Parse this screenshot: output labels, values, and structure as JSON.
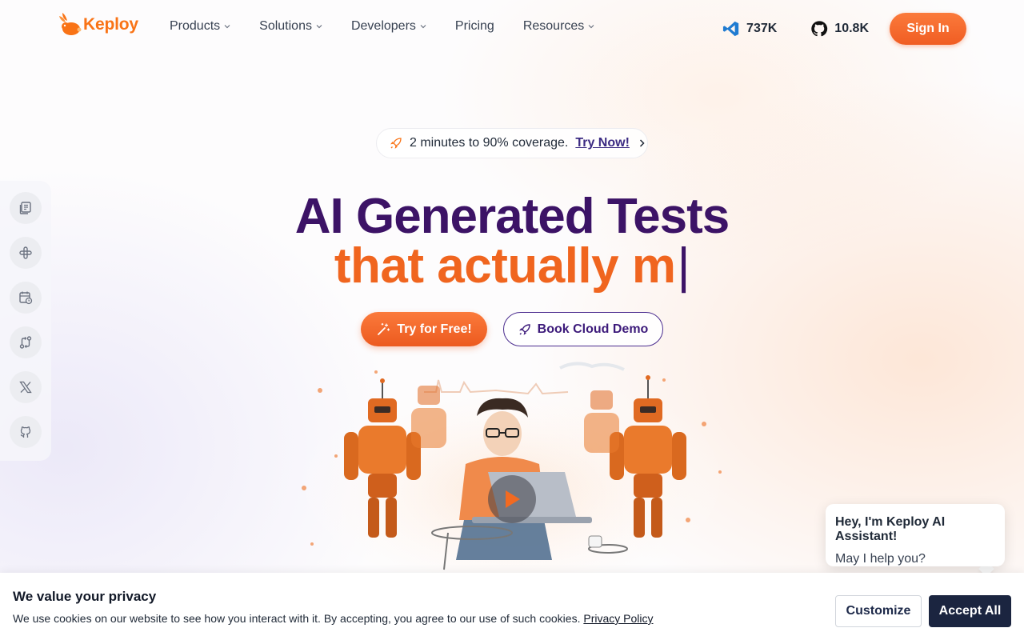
{
  "brand": {
    "name": "Keploy",
    "color": "#f97316"
  },
  "nav": {
    "items": [
      {
        "label": "Products",
        "dropdown": true
      },
      {
        "label": "Solutions",
        "dropdown": true
      },
      {
        "label": "Developers",
        "dropdown": true
      },
      {
        "label": "Pricing",
        "dropdown": false
      },
      {
        "label": "Resources",
        "dropdown": true
      }
    ],
    "vscode_count": "737K",
    "github_count": "10.8K",
    "signin_label": "Sign In"
  },
  "announcement": {
    "text": "2 minutes to 90% coverage.",
    "link": "Try Now!"
  },
  "hero": {
    "headline": "AI Generated Tests",
    "subheadline": "that actually m",
    "caret": "|",
    "cta_primary": "Try for Free!",
    "cta_secondary": "Book Cloud Demo"
  },
  "sidebar": {
    "icons": [
      "docs-icon",
      "slack-icon",
      "calendar-icon",
      "pull-request-icon",
      "x-twitter-icon",
      "github-icon"
    ]
  },
  "chat": {
    "title": "Hey, I'm Keploy AI Assistant!",
    "message": "May I help you?"
  },
  "cookie": {
    "title": "We value your privacy",
    "text": "We use cookies on our website to see how you interact with it. By accepting, you agree to our use of such cookies.",
    "policy_link": "Privacy Policy",
    "customize_label": "Customize",
    "accept_label": "Accept All"
  },
  "colors": {
    "accent_orange": "#f0651f",
    "headline_purple": "#3c1366",
    "dark_navy": "#1b2540"
  }
}
